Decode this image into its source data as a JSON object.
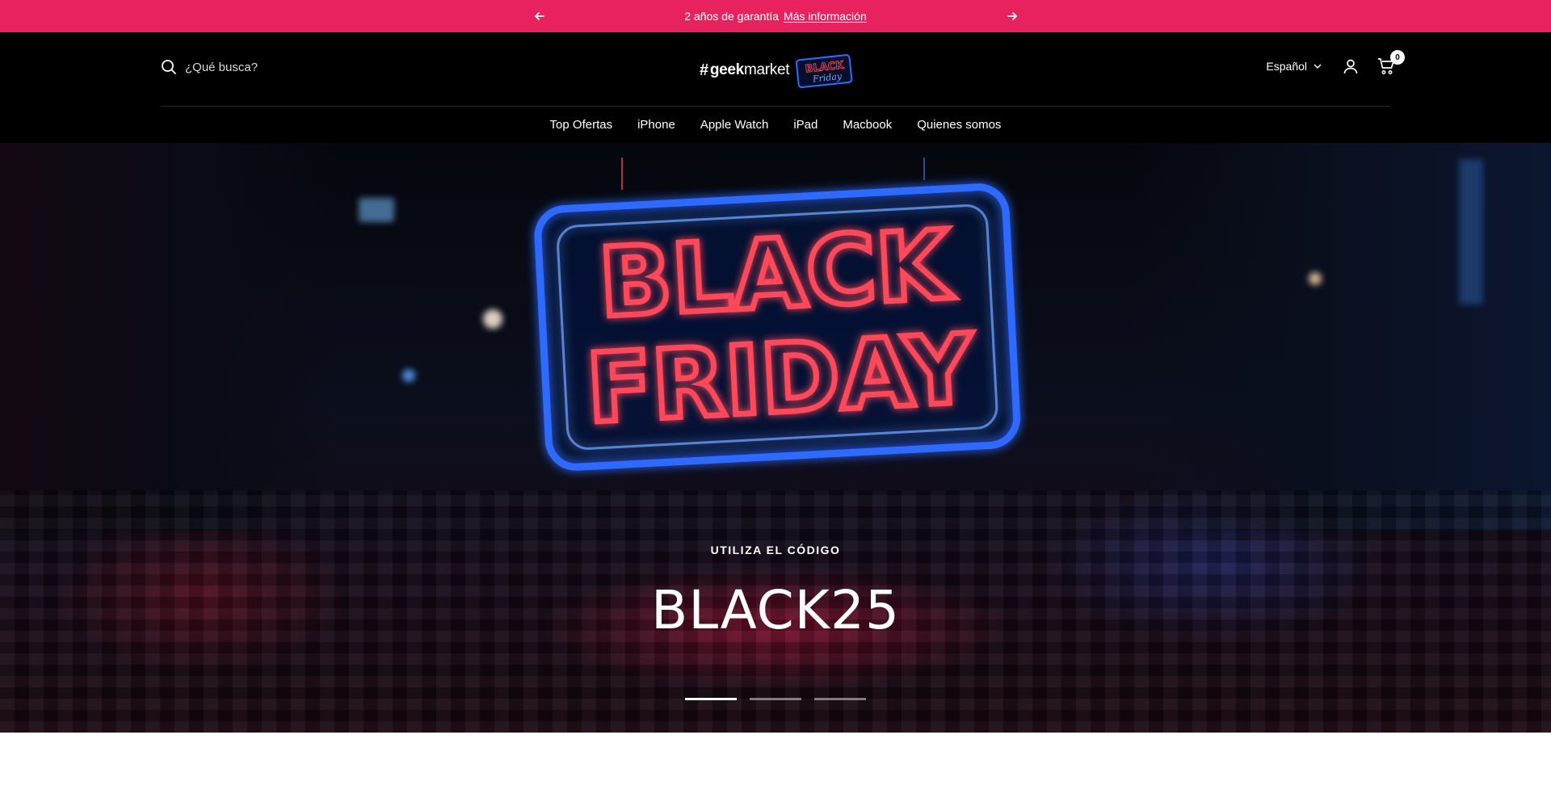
{
  "announcement": {
    "text": "2 años de garantía",
    "link": "Más información"
  },
  "header": {
    "search_placeholder": "¿Qué busca?",
    "logo": {
      "brand_prefix": "#",
      "brand_bold": "geek",
      "brand_light": "market",
      "badge_line1": "BLACK",
      "badge_line2": "Friday"
    },
    "language": "Español",
    "cart_count": "0"
  },
  "nav": {
    "items": [
      "Top Ofertas",
      "iPhone",
      "Apple Watch",
      "iPad",
      "Macbook",
      "Quienes somos"
    ]
  },
  "hero": {
    "sign_line1": "BLACK",
    "sign_line2": "FRIDAY",
    "eyebrow": "UTILIZA EL CÓDIGO",
    "headline": "BLACK25",
    "slides_total": 3,
    "slide_active": 1
  },
  "colors": {
    "announcement_bg": "#e8225f",
    "header_bg": "#000000",
    "neon_red": "#ff3b4e",
    "neon_blue": "#2f6bff"
  }
}
